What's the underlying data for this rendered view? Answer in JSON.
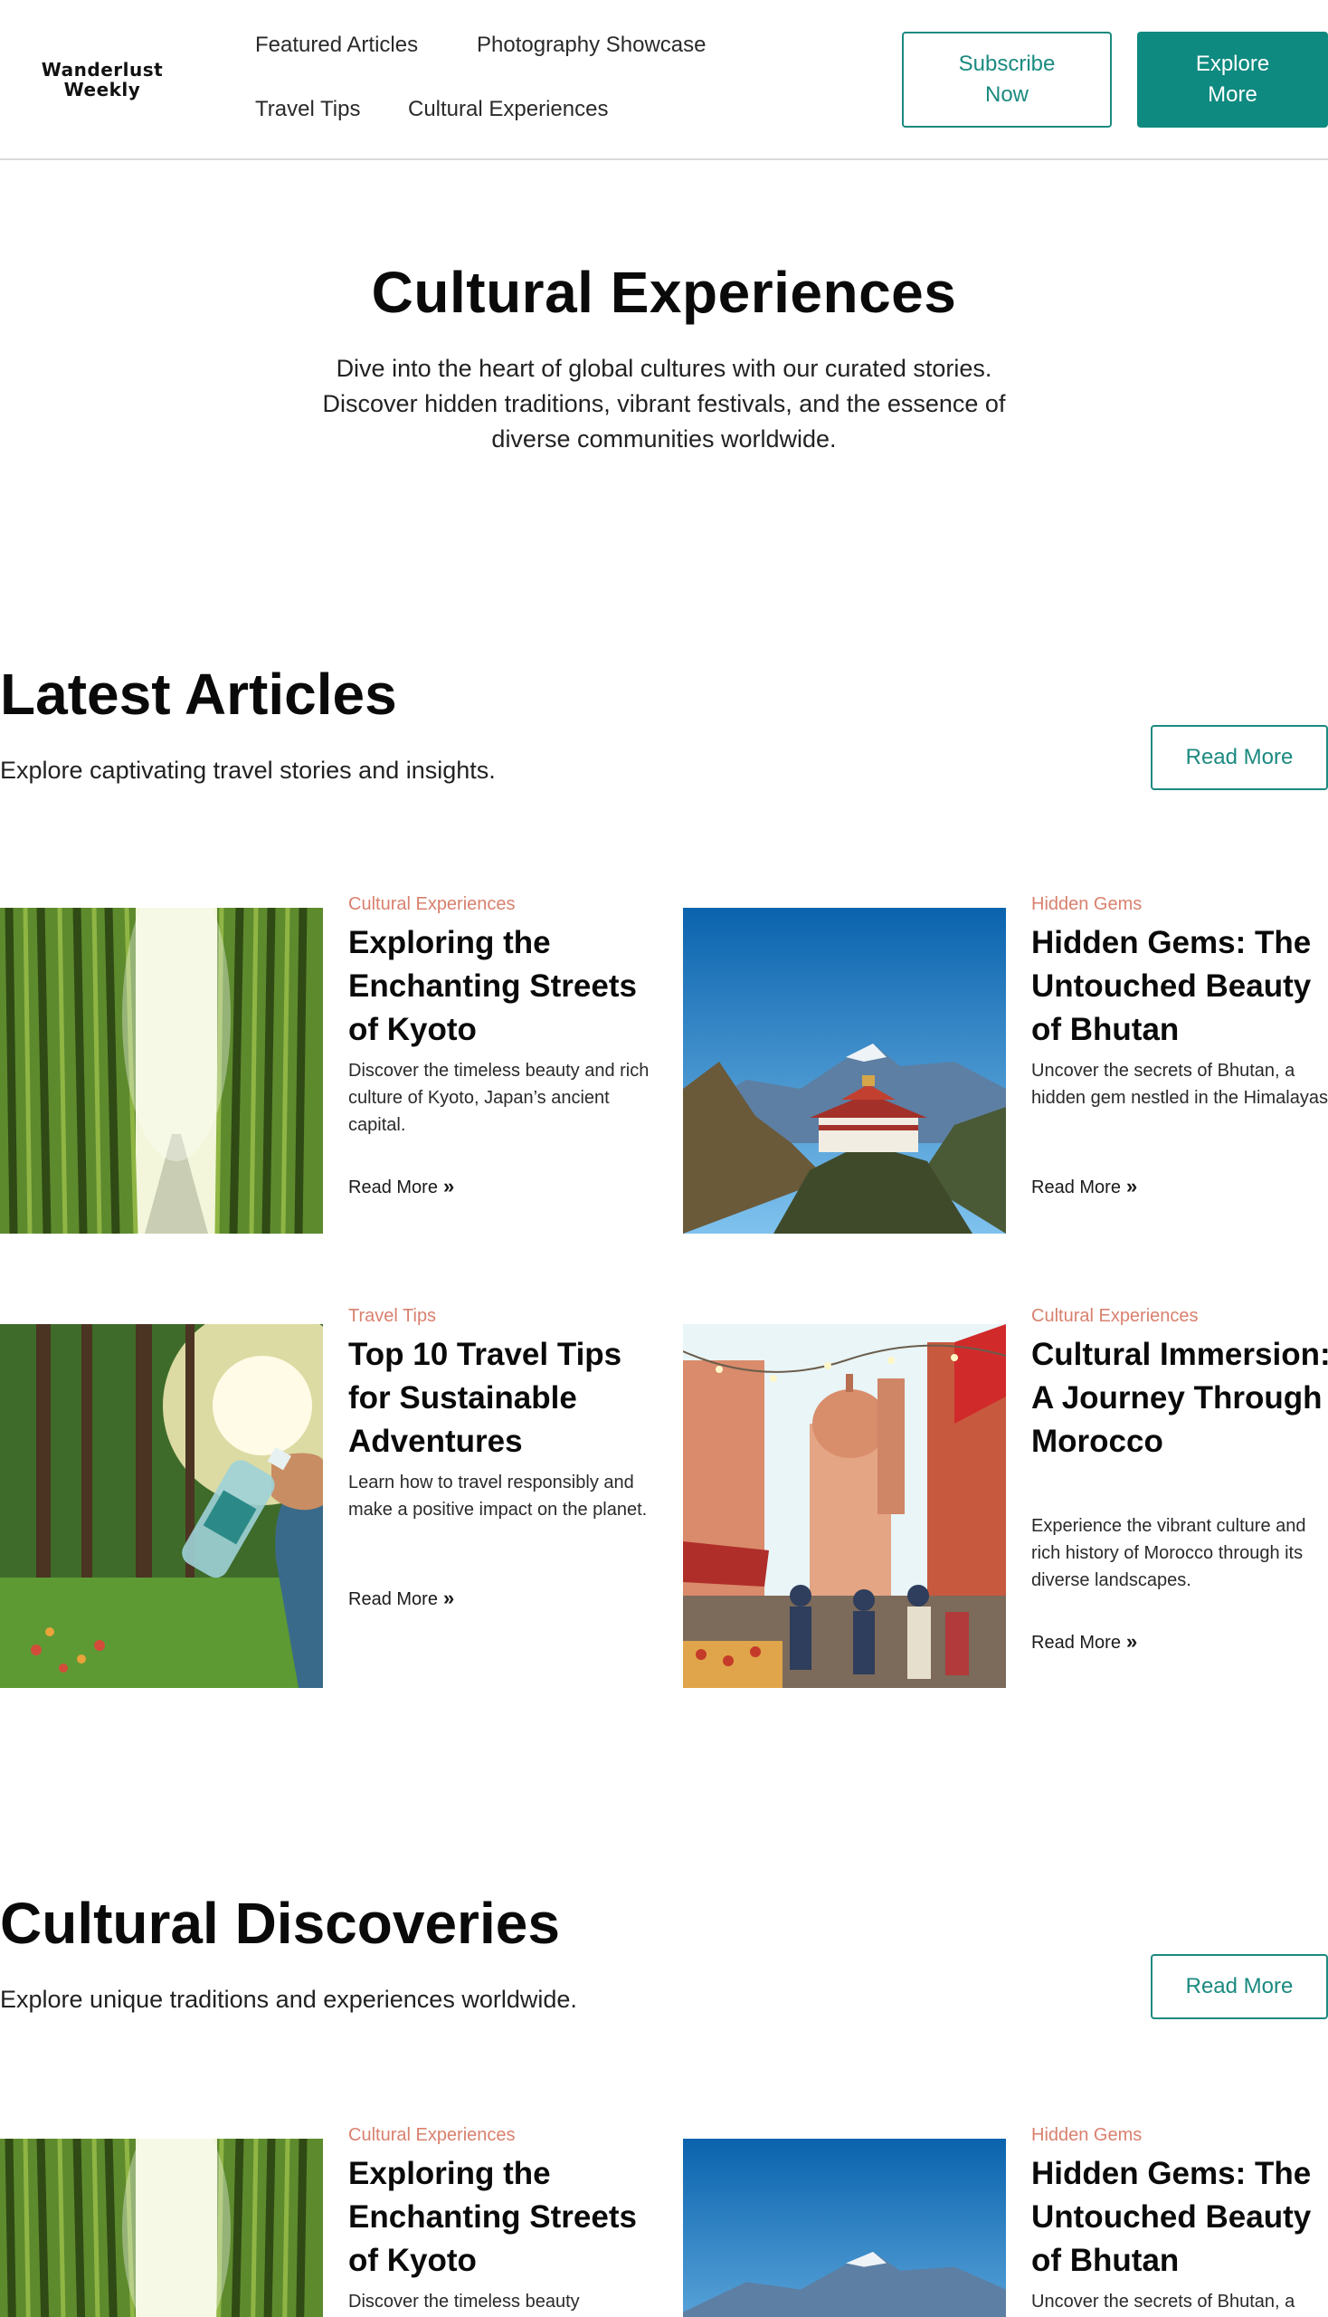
{
  "header": {
    "logo_line1": "Wanderlust",
    "logo_line2": "Weekly",
    "nav": [
      "Featured Articles",
      "Photography Showcase",
      "Travel Tips",
      "Cultural Experiences"
    ],
    "subscribe_label": "Subscribe Now",
    "explore_label": "Explore More"
  },
  "hero": {
    "title": "Cultural Experiences",
    "description": "Dive into the heart of global cultures with our curated stories. Discover hidden traditions, vibrant festivals, and the essence of diverse communities worldwide."
  },
  "latest": {
    "title": "Latest Articles",
    "subtitle": "Explore captivating travel stories and insights.",
    "button": "Read More",
    "cards": [
      {
        "category": "Cultural Experiences",
        "title": "Exploring the Enchanting Streets of Kyoto",
        "description": "Discover the timeless beauty and rich culture of Kyoto, Japan’s ancient capital.",
        "link": "Read More",
        "image": "bamboo-forest"
      },
      {
        "category": "Hidden Gems",
        "title": "Hidden Gems: The Untouched Beauty of Bhutan",
        "description": "Uncover the secrets of Bhutan, a hidden gem nestled in the Himalayas.",
        "link": "Read More",
        "image": "bhutan-monastery"
      },
      {
        "category": "Travel Tips",
        "title": "Top 10 Travel Tips for Sustainable Adventures",
        "description": "Learn how to travel responsibly and make a positive impact on the planet.",
        "link": "Read More",
        "image": "forest-water-bottle"
      },
      {
        "category": "Cultural Experiences",
        "title": "Cultural Immersion: A Journey Through Morocco",
        "description": "Experience the vibrant culture and rich history of Morocco through its diverse landscapes.",
        "link": "Read More",
        "image": "morocco-market"
      }
    ]
  },
  "discoveries": {
    "title": "Cultural Discoveries",
    "subtitle": "Explore unique traditions and experiences worldwide.",
    "button": "Read More",
    "cards": [
      {
        "category": "Cultural Experiences",
        "title": "Exploring the Enchanting Streets of Kyoto",
        "description": "Discover the timeless beauty",
        "image": "bamboo-forest"
      },
      {
        "category": "Hidden Gems",
        "title": "Hidden Gems: The Untouched Beauty of Bhutan",
        "description": "Uncover the secrets of Bhutan, a",
        "image": "bhutan-monastery"
      }
    ]
  },
  "colors": {
    "accent": "#0f8a80",
    "category": "#d9806e",
    "divider": "#d9d9d9"
  },
  "icons": {
    "read_more": "double-chevron-right-icon"
  }
}
